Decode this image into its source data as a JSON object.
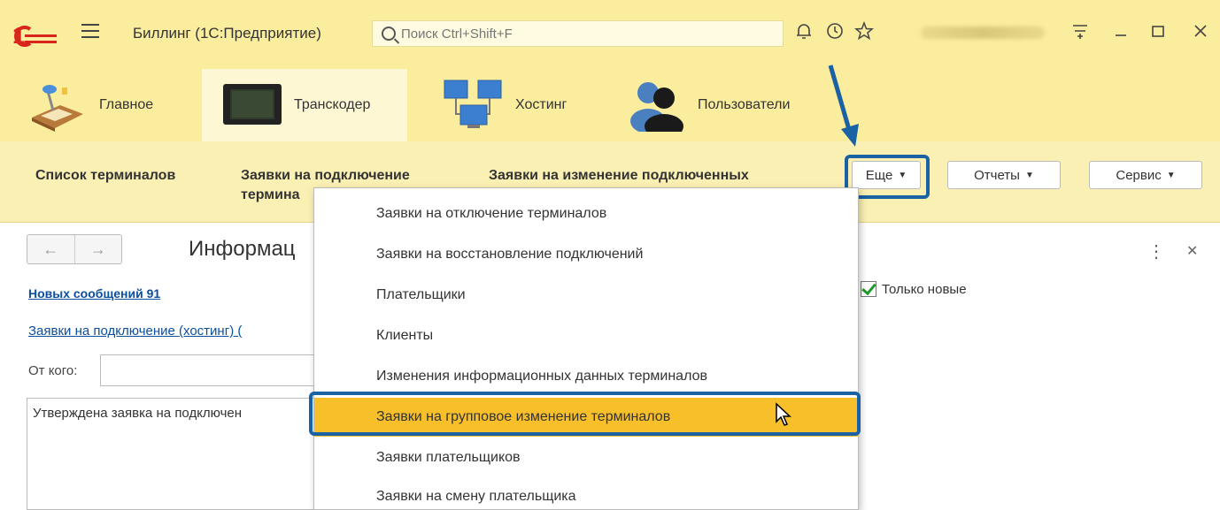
{
  "window": {
    "app_title": "Биллинг  (1С:Предприятие)",
    "search_placeholder": "Поиск Ctrl+Shift+F",
    "icons": [
      "logo-1c",
      "hamburger-icon",
      "search-icon",
      "bell-icon",
      "history-icon",
      "star-icon",
      "user-name",
      "settings-icon",
      "minimize-icon",
      "maximize-icon",
      "close-icon"
    ]
  },
  "sections": [
    {
      "label": "Главное",
      "icon": "desk-lamp-icon",
      "active": false
    },
    {
      "label": "Транскодер",
      "icon": "monitor-icon",
      "active": true
    },
    {
      "label": "Хостинг",
      "icon": "network-icon",
      "active": false
    },
    {
      "label": "Пользователи",
      "icon": "users-icon",
      "active": false
    }
  ],
  "commands": {
    "terminal_list": "Список терминалов",
    "connect_requests_1": "Заявки на подключение",
    "connect_requests_2": "термина",
    "change_requests": "Заявки на изменение подключенных",
    "more": "Еще",
    "reports": "Отчеты",
    "service": "Сервис"
  },
  "dropdown": {
    "items": [
      "Заявки на отключение терминалов",
      "Заявки на восстановление подключений",
      "Плательщики",
      "Клиенты",
      "Изменения информационных данных терминалов",
      "Заявки на групповое изменение терминалов",
      "Заявки плательщиков",
      "Заявки на смену плательщика"
    ],
    "selected_index": 5
  },
  "form": {
    "title": "Информац",
    "new_messages": "Новых сообщений 91",
    "hosting_link": "Заявки на подключение (хостинг) (",
    "from_label": "От кого:",
    "from_value": "",
    "message_text": "Утверждена заявка на подключен",
    "only_new_label": "Только новые",
    "only_new_checked": true
  },
  "colors": {
    "header_bg": "#fbed9e",
    "highlight_border": "#1a62a3",
    "selected_item": "#f7bf2a"
  }
}
